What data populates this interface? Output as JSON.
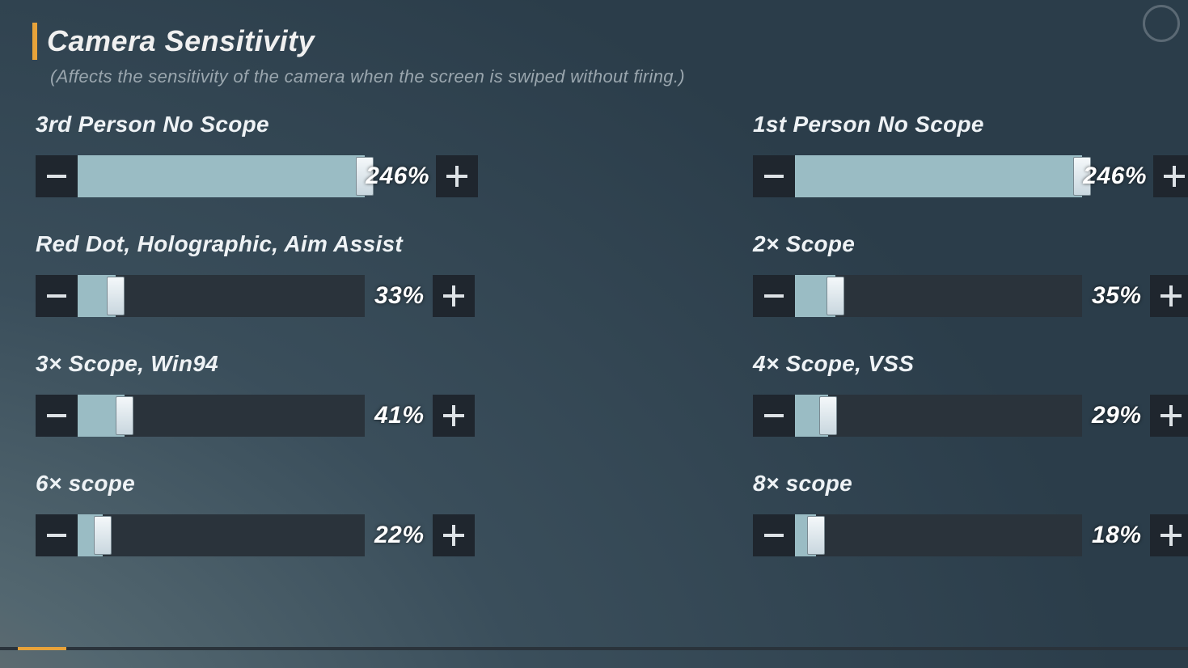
{
  "header": {
    "title": "Camera Sensitivity",
    "description": "(Affects the sensitivity of the camera when the screen is swiped without firing.)"
  },
  "max": 300,
  "settings": [
    {
      "id": "3p-noscope",
      "label": "3rd Person No Scope",
      "value": 246,
      "display": "246%"
    },
    {
      "id": "1p-noscope",
      "label": "1st Person No Scope",
      "value": 246,
      "display": "246%"
    },
    {
      "id": "reddot",
      "label": "Red Dot, Holographic, Aim Assist",
      "value": 33,
      "display": "33%"
    },
    {
      "id": "2x",
      "label": "2× Scope",
      "value": 35,
      "display": "35%"
    },
    {
      "id": "3x",
      "label": "3× Scope, Win94",
      "value": 41,
      "display": "41%"
    },
    {
      "id": "4x",
      "label": "4× Scope, VSS",
      "value": 29,
      "display": "29%"
    },
    {
      "id": "6x",
      "label": "6× scope",
      "value": 22,
      "display": "22%"
    },
    {
      "id": "8x",
      "label": "8× scope",
      "value": 18,
      "display": "18%"
    }
  ],
  "colors": {
    "accent": "#e8a33a",
    "fill": "#9abcc4",
    "track": "#2a333b",
    "button": "#1f262e"
  }
}
